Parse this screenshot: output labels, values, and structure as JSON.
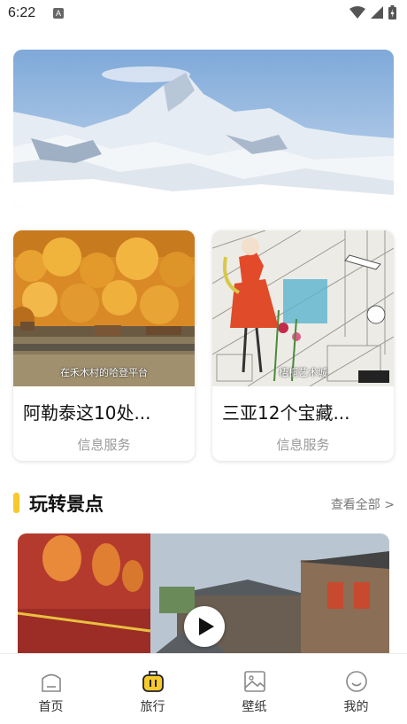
{
  "status": {
    "time": "6:22",
    "notification": "A"
  },
  "hero": {
    "icon": "mountain-landscape-image"
  },
  "cards": [
    {
      "title": "阿勒泰这10处...",
      "subtitle": "信息服务",
      "caption": "在禾木村的哈登平台"
    },
    {
      "title": "三亚12个宝藏...",
      "subtitle": "信息服务",
      "caption": "梧桐艺术城"
    }
  ],
  "section": {
    "title": "玩转景点",
    "more": "查看全部 >"
  },
  "feature": {
    "icon": "play-icon"
  },
  "tabs": [
    {
      "label": "首页",
      "icon": "home-icon"
    },
    {
      "label": "旅行",
      "icon": "suitcase-icon",
      "active": true
    },
    {
      "label": "壁纸",
      "icon": "image-icon"
    },
    {
      "label": "我的",
      "icon": "smile-icon"
    }
  ],
  "colors": {
    "accent": "#f7c92f",
    "subtitle": "#9a9a9a"
  }
}
